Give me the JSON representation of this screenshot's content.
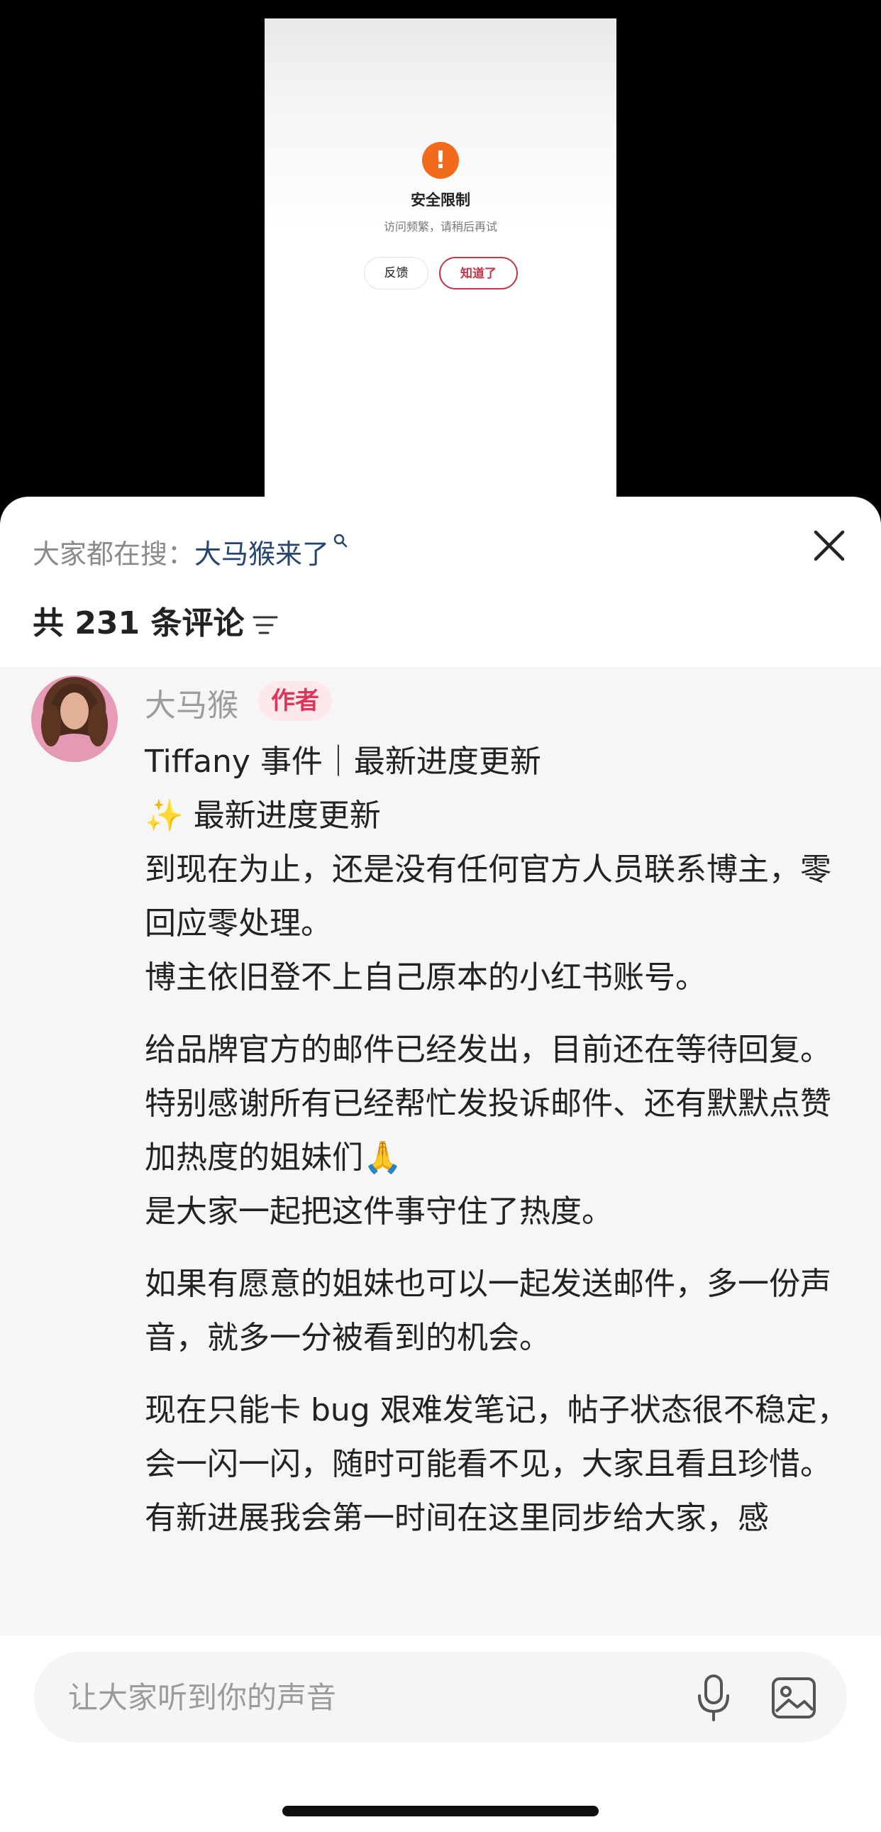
{
  "preview": {
    "title": "安全限制",
    "subtitle": "访问频繁，请稍后再试",
    "feedback_label": "反馈",
    "ok_label": "知道了",
    "icon": "warning-icon",
    "accent": "#f26a1b"
  },
  "header": {
    "hot_search_label": "大家都在搜：",
    "hot_search_term": "大马猴来了",
    "comment_count_text": "共 231 条评论",
    "close_icon": "close-icon",
    "filter_icon": "filter-icon"
  },
  "comment": {
    "author": "大马猴",
    "badge": "作者",
    "badge_color": "#e0355a",
    "paragraphs": [
      "Tiffany 事件｜最新进度更新",
      "✨ 最新进度更新",
      "到现在为止，还是没有任何官方人员联系博主，零回应零处理。",
      "博主依旧登不上自己原本的小红书账号。",
      "给品牌官方的邮件已经发出，目前还在等待回复。",
      "特别感谢所有已经帮忙发投诉邮件、还有默默点赞加热度的姐妹们🙏",
      "是大家一起把这件事守住了热度。",
      "如果有愿意的姐妹也可以一起发送邮件，多一份声音，就多一分被看到的机会。",
      "现在只能卡 bug 艰难发笔记，帖子状态很不稳定，会一闪一闪，随时可能看不见，大家且看且珍惜。",
      "有新进展我会第一时间在这里同步给大家，感"
    ]
  },
  "input": {
    "placeholder": "让大家听到你的声音",
    "mic_icon": "microphone-icon",
    "image_icon": "image-icon"
  }
}
